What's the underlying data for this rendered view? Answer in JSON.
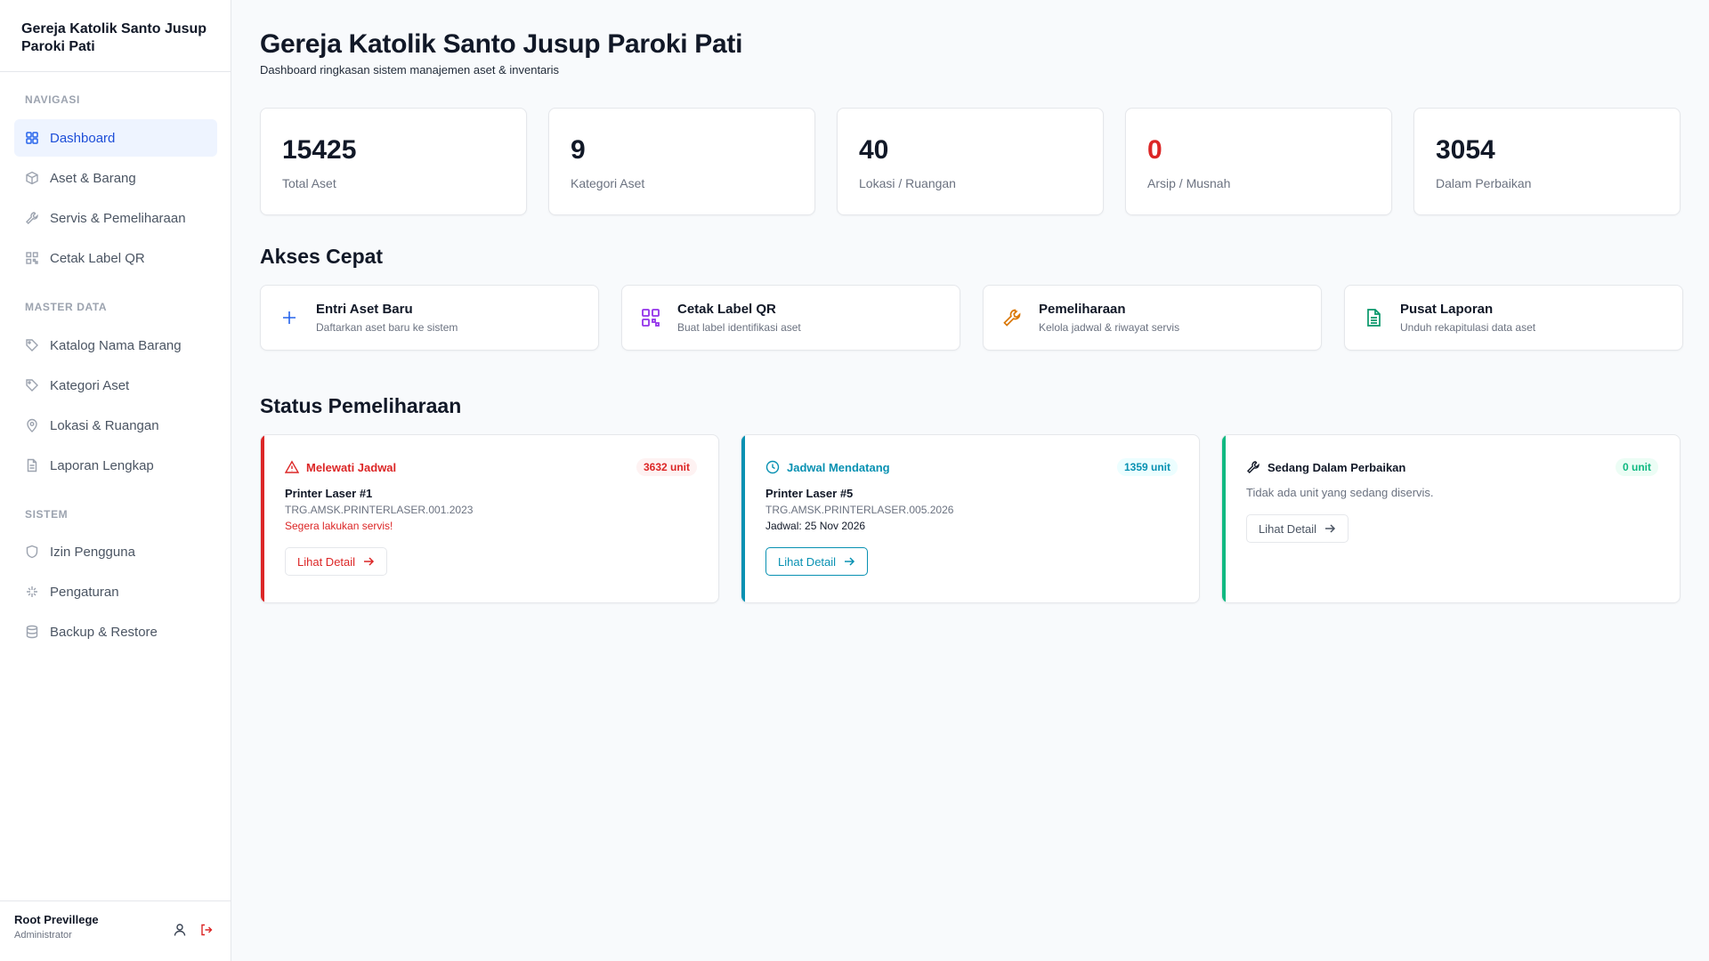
{
  "sidebar": {
    "brand": "Gereja Katolik Santo Jusup Paroki Pati",
    "sections": [
      {
        "heading": "NAVIGASI",
        "items": [
          {
            "label": "Dashboard",
            "icon": "dashboard-grid-icon",
            "active": true
          },
          {
            "label": "Aset & Barang",
            "icon": "box-icon"
          },
          {
            "label": "Servis & Pemeliharaan",
            "icon": "wrench-icon"
          },
          {
            "label": "Cetak Label QR",
            "icon": "qr-code-icon"
          }
        ]
      },
      {
        "heading": "MASTER DATA",
        "items": [
          {
            "label": "Katalog Nama Barang",
            "icon": "tag-icon"
          },
          {
            "label": "Kategori Aset",
            "icon": "tag-icon"
          },
          {
            "label": "Lokasi & Ruangan",
            "icon": "map-pin-icon"
          },
          {
            "label": "Laporan Lengkap",
            "icon": "document-icon"
          }
        ]
      },
      {
        "heading": "SISTEM",
        "items": [
          {
            "label": "Izin Pengguna",
            "icon": "shield-icon"
          },
          {
            "label": "Pengaturan",
            "icon": "settings-icon"
          },
          {
            "label": "Backup & Restore",
            "icon": "database-icon"
          }
        ]
      }
    ],
    "user": {
      "name": "Root Previllege",
      "role": "Administrator"
    }
  },
  "header": {
    "title": "Gereja Katolik Santo Jusup Paroki Pati",
    "subtitle": "Dashboard ringkasan sistem manajemen aset & inventaris"
  },
  "stats": [
    {
      "value": "15425",
      "label": "Total Aset"
    },
    {
      "value": "9",
      "label": "Kategori Aset"
    },
    {
      "value": "40",
      "label": "Lokasi / Ruangan"
    },
    {
      "value": "0",
      "label": "Arsip / Musnah",
      "color": "#dc2626"
    },
    {
      "value": "3054",
      "label": "Dalam Perbaikan"
    }
  ],
  "quick_access": {
    "title": "Akses Cepat",
    "items": [
      {
        "title": "Entri Aset Baru",
        "desc": "Daftarkan aset baru ke sistem",
        "icon": "plus-icon",
        "color": "#2563eb"
      },
      {
        "title": "Cetak Label QR",
        "desc": "Buat label identifikasi aset",
        "icon": "qr-code-icon",
        "color": "#9333ea"
      },
      {
        "title": "Pemeliharaan",
        "desc": "Kelola jadwal & riwayat servis",
        "icon": "wrench-icon",
        "color": "#d97706"
      },
      {
        "title": "Pusat Laporan",
        "desc": "Unduh rekapitulasi data aset",
        "icon": "document-icon",
        "color": "#059669"
      }
    ]
  },
  "maintenance": {
    "title": "Status Pemeliharaan",
    "cards": [
      {
        "status": "Melewati Jadwal",
        "badge": "3632 unit",
        "icon": "warning-triangle-icon",
        "accent": "#dc2626",
        "item": "Printer Laser #1",
        "code": "TRG.AMSK.PRINTERLASER.001.2023",
        "note": "Segera lakukan servis!",
        "button": "Lihat Detail"
      },
      {
        "status": "Jadwal Mendatang",
        "badge": "1359 unit",
        "icon": "clock-icon",
        "accent": "#0891b2",
        "item": "Printer Laser #5",
        "code": "TRG.AMSK.PRINTERLASER.005.2026",
        "note": "Jadwal: 25 Nov 2026",
        "button": "Lihat Detail"
      },
      {
        "status": "Sedang Dalam Perbaikan",
        "badge": "0 unit",
        "icon": "wrench-icon",
        "accent": "#10b981",
        "empty": "Tidak ada unit yang sedang diservis.",
        "button": "Lihat Detail"
      }
    ]
  }
}
